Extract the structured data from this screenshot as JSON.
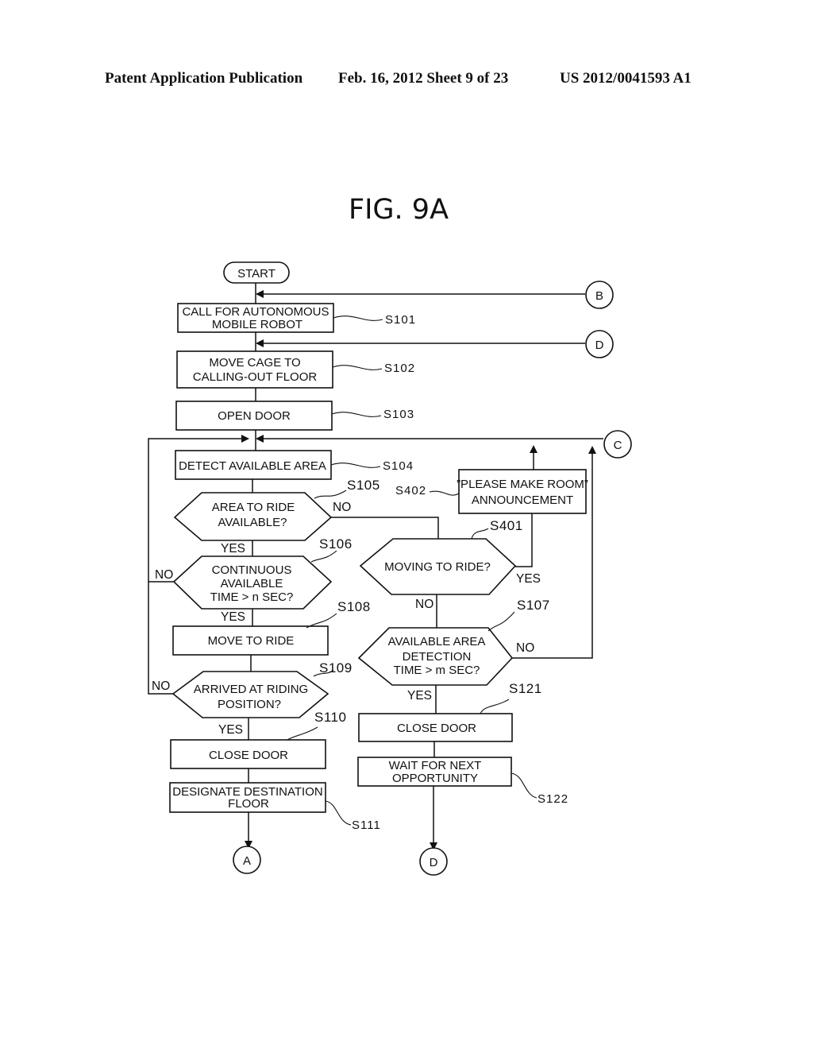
{
  "header": {
    "left": "Patent Application Publication",
    "date_sheet": "Feb. 16, 2012   Sheet 9 of 23",
    "pub_no": "US 2012/0041593 A1"
  },
  "figure": {
    "title": "FIG. 9A",
    "start": "START",
    "connectors": {
      "A": "A",
      "B": "B",
      "C": "C",
      "D_in": "D",
      "D_out": "D"
    },
    "nodes": {
      "s101": {
        "id": "S101",
        "lines": [
          "CALL FOR AUTONOMOUS",
          "MOBILE ROBOT"
        ]
      },
      "s102": {
        "id": "S102",
        "lines": [
          "MOVE CAGE TO",
          "CALLING-OUT FLOOR"
        ]
      },
      "s103": {
        "id": "S103",
        "lines": [
          "OPEN DOOR"
        ]
      },
      "s104": {
        "id": "S104",
        "lines": [
          "DETECT AVAILABLE AREA"
        ]
      },
      "s105": {
        "id": "S105",
        "lines": [
          "AREA TO RIDE",
          "AVAILABLE?"
        ]
      },
      "s106": {
        "id": "S106",
        "lines": [
          "CONTINUOUS",
          "AVAILABLE",
          "TIME > n SEC?"
        ]
      },
      "s108": {
        "id": "S108",
        "lines": [
          "MOVE TO RIDE"
        ]
      },
      "s109": {
        "id": "S109",
        "lines": [
          "ARRIVED AT RIDING",
          "POSITION?"
        ]
      },
      "s110": {
        "id": "S110",
        "lines": [
          "CLOSE DOOR"
        ]
      },
      "s111": {
        "id": "S111",
        "lines": [
          "DESIGNATE DESTINATION",
          "FLOOR"
        ]
      },
      "s401": {
        "id": "S401",
        "lines": [
          "MOVING TO RIDE?"
        ]
      },
      "s402": {
        "id": "S402",
        "lines": [
          "”PLEASE MAKE ROOM”",
          "ANNOUNCEMENT"
        ]
      },
      "s107": {
        "id": "S107",
        "lines": [
          "AVAILABLE AREA",
          "DETECTION",
          "TIME > m SEC?"
        ]
      },
      "s121": {
        "id": "S121",
        "lines": [
          "CLOSE DOOR"
        ]
      },
      "s122": {
        "id": "S122",
        "lines": [
          "WAIT FOR NEXT",
          "OPPORTUNITY"
        ]
      }
    },
    "branch_labels": {
      "s105_no": "NO",
      "s105_yes": "YES",
      "s106_no": "NO",
      "s106_yes": "YES",
      "s109_no": "NO",
      "s109_yes": "YES",
      "s401_yes": "YES",
      "s401_no": "NO",
      "s107_no": "NO",
      "s107_yes": "YES"
    }
  }
}
